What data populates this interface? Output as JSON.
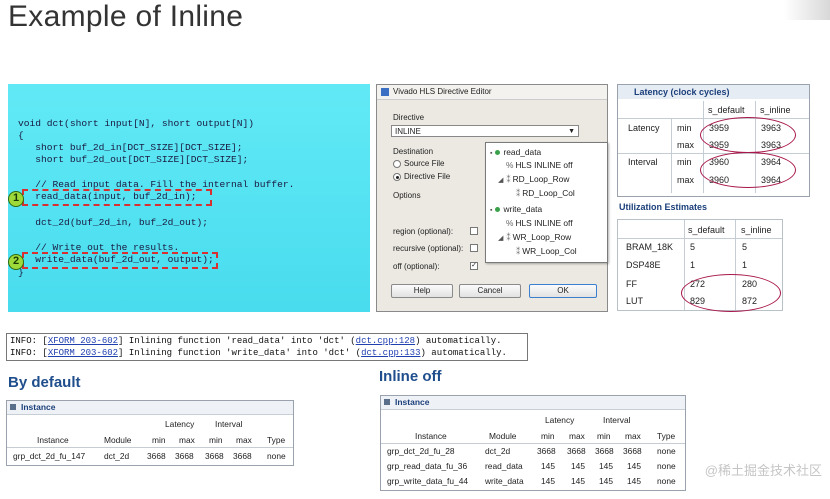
{
  "title": "Example of Inline",
  "code": {
    "lines": [
      "void dct(short input[N], short output[N])",
      "{",
      "   short buf_2d_in[DCT_SIZE][DCT_SIZE];",
      "   short buf_2d_out[DCT_SIZE][DCT_SIZE];",
      "",
      "   // Read input data. Fill the internal buffer.",
      "   read_data(input, buf_2d_in);",
      "",
      "   dct_2d(buf_2d_in, buf_2d_out);",
      "",
      "   // Write out the results.",
      "   write_data(buf_2d_out, output);",
      "}"
    ],
    "markers": [
      "1",
      "2"
    ]
  },
  "directive_editor": {
    "title": "Vivado HLS Directive Editor",
    "directive_label": "Directive",
    "directive_value": "INLINE",
    "destination_label": "Destination",
    "source_file": "Source File",
    "directive_file": "Directive File",
    "options_label": "Options",
    "region": "region (optional):",
    "recursive": "recursive (optional):",
    "off": "off (optional):",
    "help": "Help",
    "cancel": "Cancel",
    "ok": "OK",
    "tree": [
      {
        "label": "read_data",
        "kind": "func"
      },
      {
        "label": "HLS INLINE off",
        "kind": "pragma"
      },
      {
        "label": "RD_Loop_Row",
        "kind": "loop"
      },
      {
        "label": "RD_Loop_Col",
        "kind": "loop"
      },
      {
        "label": "write_data",
        "kind": "func"
      },
      {
        "label": "HLS INLINE off",
        "kind": "pragma"
      },
      {
        "label": "WR_Loop_Row",
        "kind": "loop"
      },
      {
        "label": "WR_Loop_Col",
        "kind": "loop"
      }
    ]
  },
  "latency": {
    "heading": "Latency (clock cycles)",
    "cols": [
      "s_default",
      "s_inline"
    ],
    "groups": [
      "Latency",
      "Interval"
    ],
    "sub": [
      "min",
      "max"
    ],
    "values": [
      [
        "3959",
        "3963"
      ],
      [
        "3959",
        "3963"
      ],
      [
        "3960",
        "3964"
      ],
      [
        "3960",
        "3964"
      ]
    ]
  },
  "utilization": {
    "heading": "Utilization Estimates",
    "cols": [
      "s_default",
      "s_inline"
    ],
    "rows": [
      {
        "name": "BRAM_18K",
        "d": "5",
        "i": "5"
      },
      {
        "name": "DSP48E",
        "d": "1",
        "i": "1"
      },
      {
        "name": "FF",
        "d": "272",
        "i": "280"
      },
      {
        "name": "LUT",
        "d": "829",
        "i": "872"
      }
    ]
  },
  "info": {
    "line1_pre": "INFO: [",
    "line1_link": "XFORM 203-602",
    "line1_mid": "] Inlining function 'read_data' into 'dct' (",
    "line1_file": "dct.cpp:128",
    "line1_post": ") automatically.",
    "line2_pre": "INFO: [",
    "line2_link": "XFORM 203-602",
    "line2_mid": "] Inlining function 'write_data' into 'dct' (",
    "line2_file": "dct.cpp:133",
    "line2_post": ") automatically."
  },
  "by_default": {
    "heading": "By default",
    "panel_title": "Instance",
    "hdr_latency": "Latency",
    "hdr_interval": "Interval",
    "cols": [
      "Instance",
      "Module",
      "min",
      "max",
      "min",
      "max",
      "Type"
    ],
    "rows": [
      [
        "grp_dct_2d_fu_147",
        "dct_2d",
        "3668",
        "3668",
        "3668",
        "3668",
        "none"
      ]
    ]
  },
  "inline_off": {
    "heading": "Inline off",
    "panel_title": "Instance",
    "hdr_latency": "Latency",
    "hdr_interval": "Interval",
    "cols": [
      "Instance",
      "Module",
      "min",
      "max",
      "min",
      "max",
      "Type"
    ],
    "rows": [
      [
        "grp_dct_2d_fu_28",
        "dct_2d",
        "3668",
        "3668",
        "3668",
        "3668",
        "none"
      ],
      [
        "grp_read_data_fu_36",
        "read_data",
        "145",
        "145",
        "145",
        "145",
        "none"
      ],
      [
        "grp_write_data_fu_44",
        "write_data",
        "145",
        "145",
        "145",
        "145",
        "none"
      ]
    ]
  },
  "watermark": "@稀土掘金技术社区"
}
